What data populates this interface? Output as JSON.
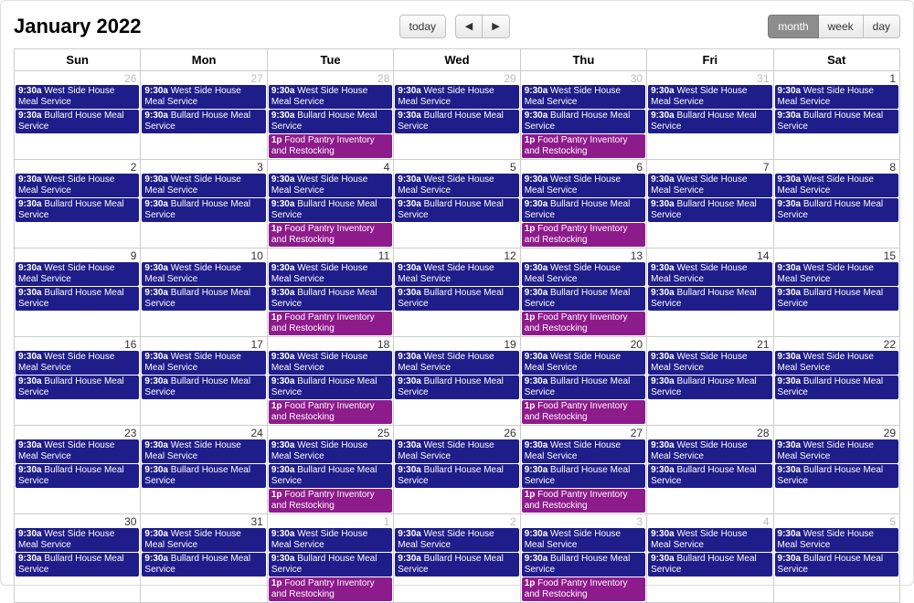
{
  "title": "January 2022",
  "toolbar": {
    "today_label": "today",
    "prev_label": "◀",
    "next_label": "▶",
    "views": {
      "month": "month",
      "week": "week",
      "day": "day"
    },
    "active_view": "month"
  },
  "day_headers": [
    "Sun",
    "Mon",
    "Tue",
    "Wed",
    "Thu",
    "Fri",
    "Sat"
  ],
  "event_templates": {
    "westside": {
      "time": "9:30a",
      "title": "West Side House Meal Service",
      "color": "navy"
    },
    "bullard": {
      "time": "9:30a",
      "title": "Bullard House Meal Service",
      "color": "navy"
    },
    "pantry": {
      "time": "1p",
      "title": "Food Pantry Inventory and Restocking",
      "color": "magenta"
    }
  },
  "weeks": [
    [
      {
        "day": 26,
        "other": true,
        "events": [
          "westside",
          "bullard"
        ]
      },
      {
        "day": 27,
        "other": true,
        "events": [
          "westside",
          "bullard"
        ]
      },
      {
        "day": 28,
        "other": true,
        "events": [
          "westside",
          "bullard",
          "pantry"
        ]
      },
      {
        "day": 29,
        "other": true,
        "events": [
          "westside",
          "bullard"
        ]
      },
      {
        "day": 30,
        "other": true,
        "events": [
          "westside",
          "bullard",
          "pantry"
        ]
      },
      {
        "day": 31,
        "other": true,
        "events": [
          "westside",
          "bullard"
        ]
      },
      {
        "day": 1,
        "other": false,
        "events": [
          "westside",
          "bullard"
        ]
      }
    ],
    [
      {
        "day": 2,
        "other": false,
        "events": [
          "westside",
          "bullard"
        ]
      },
      {
        "day": 3,
        "other": false,
        "events": [
          "westside",
          "bullard"
        ]
      },
      {
        "day": 4,
        "other": false,
        "events": [
          "westside",
          "bullard",
          "pantry"
        ]
      },
      {
        "day": 5,
        "other": false,
        "events": [
          "westside",
          "bullard"
        ]
      },
      {
        "day": 6,
        "other": false,
        "events": [
          "westside",
          "bullard",
          "pantry"
        ]
      },
      {
        "day": 7,
        "other": false,
        "events": [
          "westside",
          "bullard"
        ]
      },
      {
        "day": 8,
        "other": false,
        "events": [
          "westside",
          "bullard"
        ]
      }
    ],
    [
      {
        "day": 9,
        "other": false,
        "events": [
          "westside",
          "bullard"
        ]
      },
      {
        "day": 10,
        "other": false,
        "events": [
          "westside",
          "bullard"
        ]
      },
      {
        "day": 11,
        "other": false,
        "events": [
          "westside",
          "bullard",
          "pantry"
        ]
      },
      {
        "day": 12,
        "other": false,
        "events": [
          "westside",
          "bullard"
        ]
      },
      {
        "day": 13,
        "other": false,
        "events": [
          "westside",
          "bullard",
          "pantry"
        ]
      },
      {
        "day": 14,
        "other": false,
        "events": [
          "westside",
          "bullard"
        ]
      },
      {
        "day": 15,
        "other": false,
        "events": [
          "westside",
          "bullard"
        ]
      }
    ],
    [
      {
        "day": 16,
        "other": false,
        "events": [
          "westside",
          "bullard"
        ]
      },
      {
        "day": 17,
        "other": false,
        "events": [
          "westside",
          "bullard"
        ]
      },
      {
        "day": 18,
        "other": false,
        "events": [
          "westside",
          "bullard",
          "pantry"
        ]
      },
      {
        "day": 19,
        "other": false,
        "events": [
          "westside",
          "bullard"
        ]
      },
      {
        "day": 20,
        "other": false,
        "events": [
          "westside",
          "bullard",
          "pantry"
        ]
      },
      {
        "day": 21,
        "other": false,
        "events": [
          "westside",
          "bullard"
        ]
      },
      {
        "day": 22,
        "other": false,
        "events": [
          "westside",
          "bullard"
        ]
      }
    ],
    [
      {
        "day": 23,
        "other": false,
        "events": [
          "westside",
          "bullard"
        ]
      },
      {
        "day": 24,
        "other": false,
        "events": [
          "westside",
          "bullard"
        ]
      },
      {
        "day": 25,
        "other": false,
        "events": [
          "westside",
          "bullard",
          "pantry"
        ]
      },
      {
        "day": 26,
        "other": false,
        "events": [
          "westside",
          "bullard"
        ]
      },
      {
        "day": 27,
        "other": false,
        "events": [
          "westside",
          "bullard",
          "pantry"
        ]
      },
      {
        "day": 28,
        "other": false,
        "events": [
          "westside",
          "bullard"
        ]
      },
      {
        "day": 29,
        "other": false,
        "events": [
          "westside",
          "bullard"
        ]
      }
    ],
    [
      {
        "day": 30,
        "other": false,
        "events": [
          "westside",
          "bullard"
        ]
      },
      {
        "day": 31,
        "other": false,
        "events": [
          "westside",
          "bullard"
        ]
      },
      {
        "day": 1,
        "other": true,
        "events": [
          "westside",
          "bullard",
          "pantry"
        ]
      },
      {
        "day": 2,
        "other": true,
        "events": [
          "westside",
          "bullard"
        ]
      },
      {
        "day": 3,
        "other": true,
        "events": [
          "westside",
          "bullard",
          "pantry"
        ]
      },
      {
        "day": 4,
        "other": true,
        "events": [
          "westside",
          "bullard"
        ]
      },
      {
        "day": 5,
        "other": true,
        "events": [
          "westside",
          "bullard"
        ]
      }
    ]
  ]
}
